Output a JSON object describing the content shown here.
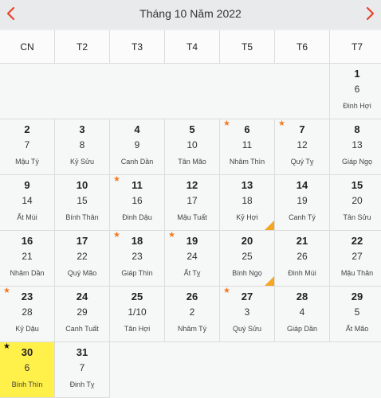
{
  "header": {
    "title": "Tháng 10 Năm 2022"
  },
  "weekdays": [
    "CN",
    "T2",
    "T3",
    "T4",
    "T5",
    "T6",
    "T7"
  ],
  "colors": {
    "accent": "#e8452c",
    "star": "#f47a22",
    "today": "#fff04a",
    "corner": "#f5a623"
  },
  "days": [
    {
      "day": "1",
      "lunar": "6",
      "canchi": "Đinh Hợi",
      "star": "",
      "corner": false
    },
    {
      "day": "2",
      "lunar": "7",
      "canchi": "Mậu Tý",
      "star": "",
      "corner": false
    },
    {
      "day": "3",
      "lunar": "8",
      "canchi": "Kỷ Sửu",
      "star": "",
      "corner": false
    },
    {
      "day": "4",
      "lunar": "9",
      "canchi": "Canh Dần",
      "star": "",
      "corner": false
    },
    {
      "day": "5",
      "lunar": "10",
      "canchi": "Tân Mão",
      "star": "",
      "corner": false
    },
    {
      "day": "6",
      "lunar": "11",
      "canchi": "Nhâm Thìn",
      "star": "★",
      "corner": false
    },
    {
      "day": "7",
      "lunar": "12",
      "canchi": "Quý Tỵ",
      "star": "★",
      "corner": false
    },
    {
      "day": "8",
      "lunar": "13",
      "canchi": "Giáp Ngọ",
      "star": "",
      "corner": false
    },
    {
      "day": "9",
      "lunar": "14",
      "canchi": "Ất Mùi",
      "star": "",
      "corner": false
    },
    {
      "day": "10",
      "lunar": "15",
      "canchi": "Bính Thân",
      "star": "",
      "corner": false
    },
    {
      "day": "11",
      "lunar": "16",
      "canchi": "Đinh Dậu",
      "star": "★",
      "corner": false
    },
    {
      "day": "12",
      "lunar": "17",
      "canchi": "Mậu Tuất",
      "star": "",
      "corner": false
    },
    {
      "day": "13",
      "lunar": "18",
      "canchi": "Kỷ Hợi",
      "star": "",
      "corner": true
    },
    {
      "day": "14",
      "lunar": "19",
      "canchi": "Canh Tý",
      "star": "",
      "corner": false
    },
    {
      "day": "15",
      "lunar": "20",
      "canchi": "Tân Sửu",
      "star": "",
      "corner": false
    },
    {
      "day": "16",
      "lunar": "21",
      "canchi": "Nhâm Dần",
      "star": "",
      "corner": false
    },
    {
      "day": "17",
      "lunar": "22",
      "canchi": "Quý Mão",
      "star": "",
      "corner": false
    },
    {
      "day": "18",
      "lunar": "23",
      "canchi": "Giáp Thìn",
      "star": "★",
      "corner": false
    },
    {
      "day": "19",
      "lunar": "24",
      "canchi": "Ất Tỵ",
      "star": "★",
      "corner": false
    },
    {
      "day": "20",
      "lunar": "25",
      "canchi": "Bính Ngọ",
      "star": "",
      "corner": true
    },
    {
      "day": "21",
      "lunar": "26",
      "canchi": "Đinh Mùi",
      "star": "",
      "corner": false
    },
    {
      "day": "22",
      "lunar": "27",
      "canchi": "Mậu Thân",
      "star": "",
      "corner": false
    },
    {
      "day": "23",
      "lunar": "28",
      "canchi": "Kỷ Dậu",
      "star": "★",
      "corner": false
    },
    {
      "day": "24",
      "lunar": "29",
      "canchi": "Canh Tuất",
      "star": "",
      "corner": false
    },
    {
      "day": "25",
      "lunar": "1/10",
      "canchi": "Tân Hợi",
      "star": "",
      "corner": false
    },
    {
      "day": "26",
      "lunar": "2",
      "canchi": "Nhâm Tý",
      "star": "",
      "corner": false
    },
    {
      "day": "27",
      "lunar": "3",
      "canchi": "Quý Sửu",
      "star": "★",
      "corner": false
    },
    {
      "day": "28",
      "lunar": "4",
      "canchi": "Giáp Dần",
      "star": "",
      "corner": false
    },
    {
      "day": "29",
      "lunar": "5",
      "canchi": "Ất Mão",
      "star": "",
      "corner": false
    },
    {
      "day": "30",
      "lunar": "6",
      "canchi": "Bính Thìn",
      "star": "★",
      "corner": false,
      "today": true
    },
    {
      "day": "31",
      "lunar": "7",
      "canchi": "Đinh Tỵ",
      "star": "",
      "corner": false
    }
  ]
}
